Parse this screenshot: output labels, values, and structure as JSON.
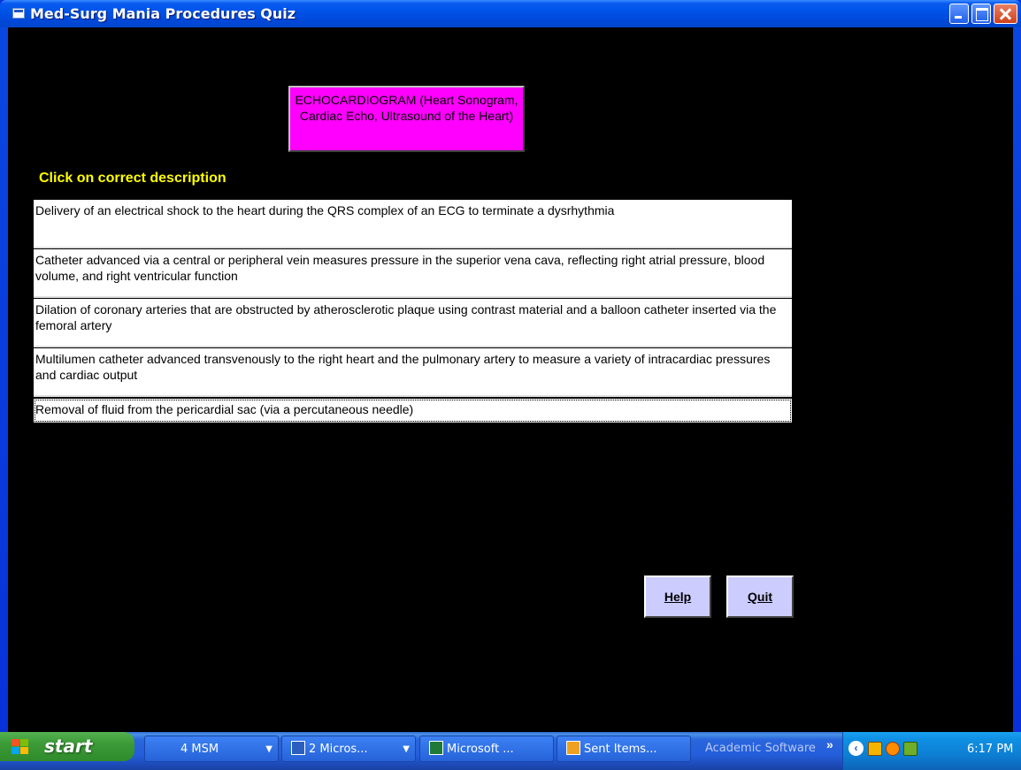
{
  "window": {
    "title": "Med-Surg Mania Procedures Quiz"
  },
  "quiz": {
    "term": "ECHOCARDIOGRAM (Heart Sonogram, Cardiac Echo, Ultrasound of the Heart)",
    "instruction": "Click on correct description",
    "options": [
      "Delivery of an electrical shock to the heart during the QRS complex of an ECG to terminate a dysrhythmia",
      "Catheter advanced via a central or peripheral vein measures pressure in the superior vena cava, reflecting right atrial pressure, blood volume, and right ventricular function",
      "Dilation of coronary arteries that are obstructed by atherosclerotic plaque using contrast material and a balloon catheter inserted via the femoral artery",
      "Multilumen catheter advanced transvenously to the right heart and the pulmonary artery to measure a variety of intracardiac pressures and cardiac output",
      "Removal of fluid from the pericardial sac (via a percutaneous needle)"
    ],
    "term_box_color": "#ff00ff",
    "instruction_color": "#ffff00"
  },
  "buttons": {
    "help_label": "Help",
    "quit_label": "Quit"
  },
  "taskbar": {
    "start_label": "start",
    "tasks": [
      {
        "label": "4 MSM",
        "icon": "app-group-icon"
      },
      {
        "label": "2 Micros...",
        "icon": "word-icon"
      },
      {
        "label": "Microsoft ...",
        "icon": "excel-icon"
      },
      {
        "label": "Sent Items...",
        "icon": "outlook-icon"
      },
      {
        "label": "Academic Software",
        "icon": ""
      }
    ],
    "clock": "6:17 PM"
  }
}
